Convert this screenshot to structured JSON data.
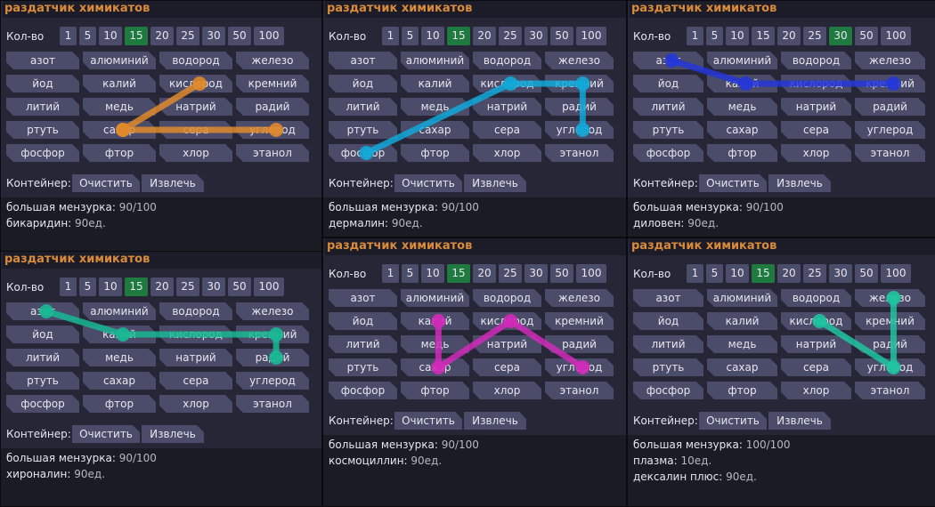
{
  "title": "раздатчик химикатов",
  "qty_label": "Кол-во",
  "amounts": [
    "1",
    "5",
    "10",
    "15",
    "20",
    "25",
    "30",
    "50",
    "100"
  ],
  "chemicals": [
    [
      "азот",
      "алюминий",
      "водород",
      "железо"
    ],
    [
      "йод",
      "калий",
      "кислород",
      "кремний"
    ],
    [
      "литий",
      "медь",
      "натрий",
      "радий"
    ],
    [
      "ртуть",
      "сахар",
      "сера",
      "углерод"
    ],
    [
      "фосфор",
      "фтор",
      "хлор",
      "этанол"
    ]
  ],
  "container_label": "Контейнер:",
  "clear_label": "Очистить",
  "extract_label": "Извлечь",
  "colors": {
    "title": "#d98b3a",
    "panel": "#262636",
    "button": "#4a4c6a",
    "selected": "#1e7a3e"
  },
  "panels": [
    {
      "selected_amount": "15",
      "beaker_label": "большая мензурка:",
      "beaker_value": "90/100",
      "contents": [
        {
          "name": "бикаридин:",
          "amount": "90ед."
        }
      ],
      "path": {
        "color": "#e08a2c",
        "cells": [
          [
            3,
            1
          ],
          [
            1,
            2
          ],
          [
            3,
            1
          ],
          [
            3,
            3
          ]
        ]
      }
    },
    {
      "selected_amount": "15",
      "beaker_label": "большая мензурка:",
      "beaker_value": "90/100",
      "contents": [
        {
          "name": "дермалин:",
          "amount": "90ед."
        }
      ],
      "path": {
        "color": "#12a8d8",
        "cells": [
          [
            4,
            0
          ],
          [
            1,
            2
          ],
          [
            1,
            3
          ],
          [
            3,
            3
          ]
        ]
      }
    },
    {
      "selected_amount": "30",
      "beaker_label": "большая мензурка:",
      "beaker_value": "90/100",
      "contents": [
        {
          "name": "диловен:",
          "amount": "90ед."
        }
      ],
      "path": {
        "color": "#2436d8",
        "cells": [
          [
            0,
            0
          ],
          [
            1,
            1
          ],
          [
            1,
            3
          ]
        ]
      }
    },
    {
      "selected_amount": "15",
      "beaker_label": "большая мензурка:",
      "beaker_value": "90/100",
      "contents": [
        {
          "name": "хироналин:",
          "amount": "90ед."
        }
      ],
      "path": {
        "color": "#18b894",
        "cells": [
          [
            0,
            0
          ],
          [
            1,
            1
          ],
          [
            1,
            3
          ],
          [
            2,
            3
          ]
        ]
      }
    },
    {
      "selected_amount": "15",
      "beaker_label": "большая мензурка:",
      "beaker_value": "90/100",
      "contents": [
        {
          "name": "космоциллин:",
          "amount": "90ед."
        }
      ],
      "path": {
        "color": "#d02ab8",
        "cells": [
          [
            1,
            1
          ],
          [
            3,
            1
          ],
          [
            1,
            2
          ],
          [
            3,
            3
          ]
        ]
      }
    },
    {
      "selected_amount": "15",
      "beaker_label": "большая мензурка:",
      "beaker_value": "100/100",
      "contents": [
        {
          "name": "плазма:",
          "amount": "10ед."
        },
        {
          "name": "дексалин плюс:",
          "amount": "90ед."
        }
      ],
      "path": {
        "color": "#1ec4a0",
        "cells": [
          [
            0,
            3
          ],
          [
            3,
            3
          ],
          [
            1,
            2
          ]
        ]
      }
    }
  ]
}
